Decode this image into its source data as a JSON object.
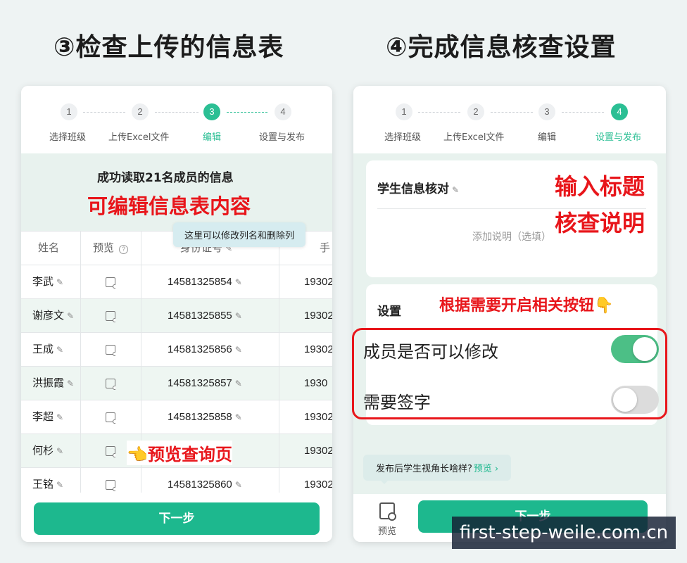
{
  "left_title": "③检查上传的信息表",
  "right_title": "④完成信息核查设置",
  "steps": [
    {
      "num": "1",
      "label": "选择班级"
    },
    {
      "num": "2",
      "label": "上传Excel文件"
    },
    {
      "num": "3",
      "label": "编辑"
    },
    {
      "num": "4",
      "label": "设置与发布"
    }
  ],
  "left": {
    "success_msg": "成功读取21名成员的信息",
    "annotation_edit": "可编辑信息表内容",
    "tooltip": "这里可以修改列名和删除列",
    "columns": [
      "姓名",
      "预览",
      "身份证号",
      "手"
    ],
    "rows": [
      {
        "name": "李武",
        "id": "14581325854",
        "phone": "19302"
      },
      {
        "name": "谢彦文",
        "id": "14581325855",
        "phone": "19302"
      },
      {
        "name": "王成",
        "id": "14581325856",
        "phone": "19302"
      },
      {
        "name": "洪振霞",
        "id": "14581325857",
        "phone": "1930"
      },
      {
        "name": "李超",
        "id": "14581325858",
        "phone": "19302"
      },
      {
        "name": "何杉",
        "id": "",
        "phone": "19302"
      },
      {
        "name": "王铭",
        "id": "14581325860",
        "phone": "19302"
      }
    ],
    "annotation_preview": "👈预览查询页",
    "next_button": "下一步"
  },
  "right": {
    "form_title": "学生信息核对",
    "description_placeholder": "添加说明（选填）",
    "annotation_title_1": "输入标题",
    "annotation_title_2": "核查说明",
    "settings_label": "设置",
    "annotation_settings": "根据需要开启相关按钮👇",
    "toggles": [
      {
        "label": "成员是否可以修改",
        "on": true
      },
      {
        "label": "需要签字",
        "on": false
      }
    ],
    "preview_hint": "发布后学生视角长啥样?",
    "preview_link": "预览",
    "preview_tab": "预览",
    "next_button": "下一步"
  },
  "watermark": "first-step-weile.com.cn",
  "colors": {
    "accent": "#1db88e",
    "annotation_red": "#e8161b",
    "panel_bg": "#e8f2ee"
  }
}
